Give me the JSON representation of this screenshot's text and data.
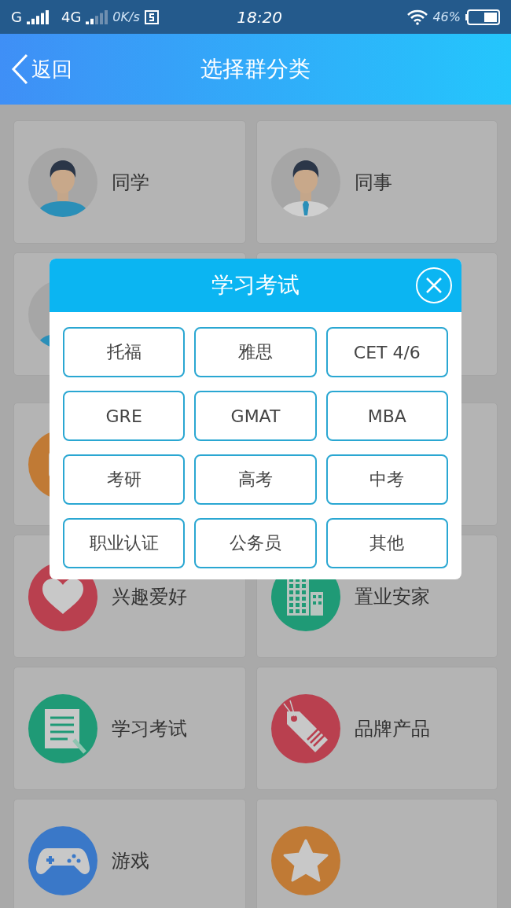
{
  "status_bar": {
    "network_1": "G",
    "network_2": "4G",
    "speed": "0K/s",
    "time": "18:20",
    "battery": "46%"
  },
  "header": {
    "back": "返回",
    "title": "选择群分类"
  },
  "sections": [
    {
      "cards": [
        {
          "kind": "student",
          "label": "同学"
        },
        {
          "kind": "colleague",
          "label": "同事"
        },
        {
          "kind": "person"
        },
        {
          "kind": "blank"
        }
      ]
    },
    {
      "cards": [
        {
          "kind": "badge"
        },
        {
          "kind": "blank"
        },
        {
          "kind": "heart",
          "label": "兴趣爱好"
        },
        {
          "kind": "building",
          "label": "置业安家"
        },
        {
          "kind": "document",
          "label": "学习考试"
        },
        {
          "kind": "tag",
          "label": "品牌产品"
        },
        {
          "kind": "gamepad",
          "label": "游戏"
        },
        {
          "kind": "star"
        }
      ]
    }
  ],
  "dialog": {
    "title": "学习考试",
    "options": [
      "托福",
      "雅思",
      "CET 4/6",
      "GRE",
      "GMAT",
      "MBA",
      "考研",
      "高考",
      "中考",
      "职业认证",
      "公务员",
      "其他"
    ]
  }
}
